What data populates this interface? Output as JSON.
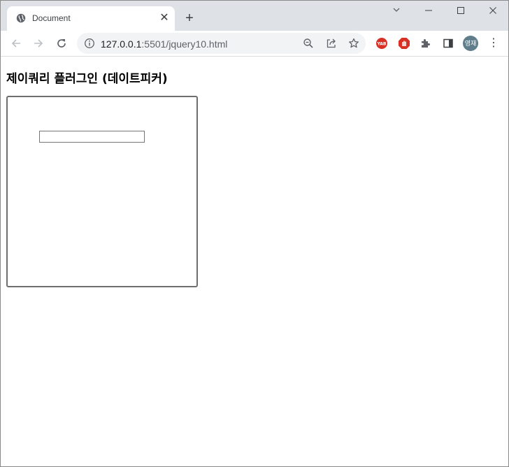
{
  "browser": {
    "tab": {
      "title": "Document",
      "favicon": "globe-icon",
      "close_glyph": "✕"
    },
    "new_tab_glyph": "+",
    "window_controls": {
      "tab_search_glyph": "⌄",
      "minimize_glyph": "—",
      "maximize_glyph": "☐",
      "close_glyph": "✕"
    },
    "address_bar": {
      "url_host": "127.0.0.1",
      "url_rest": ":5501/jquery10.html"
    },
    "profile_avatar_text": "영재",
    "menu_glyph": "⋮",
    "extensions": [
      {
        "name": "yab-extension-icon",
        "label": "YAB",
        "color": "#d93025"
      },
      {
        "name": "adblock-extension-icon",
        "label": "✋",
        "color": "#d93025"
      }
    ]
  },
  "page": {
    "heading": "제이쿼리 플러그인 (데이트피커)",
    "date_input": {
      "value": "",
      "placeholder": ""
    }
  }
}
